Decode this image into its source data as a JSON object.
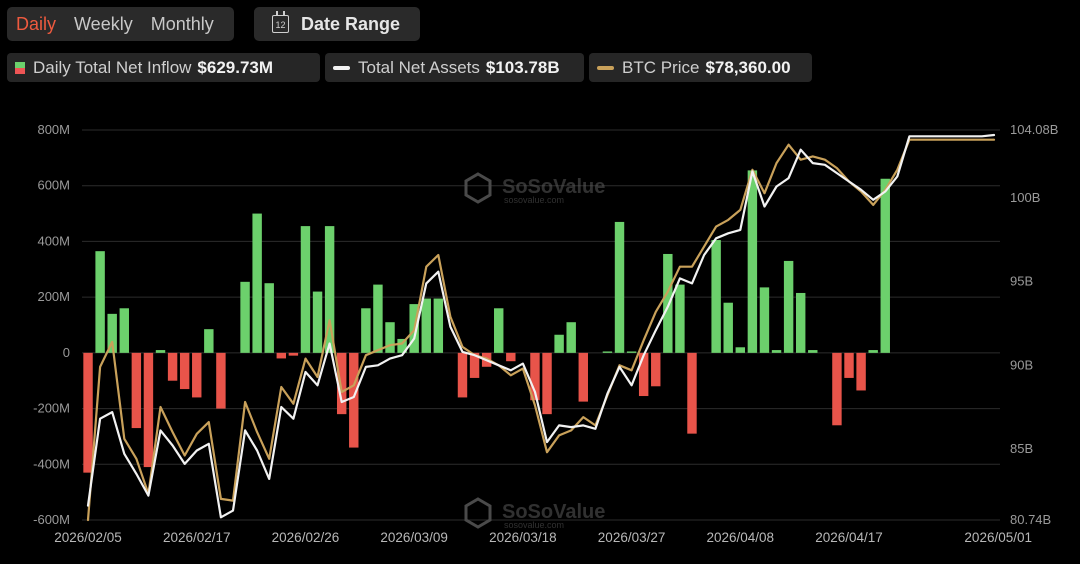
{
  "toolbar": {
    "tabs": [
      "Daily",
      "Weekly",
      "Monthly"
    ],
    "active_tab": "Daily",
    "date_range_label": "Date Range",
    "calendar_icon_text": "12"
  },
  "legend": {
    "inflow": {
      "name": "Daily Total Net Inflow",
      "value": "$629.73M",
      "color_in": "#6cd06c",
      "color_out": "#e8544a"
    },
    "assets": {
      "name": "Total Net Assets",
      "value": "$103.78B",
      "color": "#f2f2f2"
    },
    "btc": {
      "name": "BTC Price",
      "value": "$78,360.00",
      "color": "#c9a15a"
    }
  },
  "watermark": {
    "brand": "SoSoValue",
    "domain": "sosovalue.com"
  },
  "chart_data": {
    "type": "bar+line",
    "left_axis": {
      "ticks": [
        "800M",
        "600M",
        "400M",
        "200M",
        "0",
        "-200M",
        "-400M",
        "-600M"
      ],
      "min": -600,
      "max": 800,
      "unit": "M"
    },
    "right_axis": {
      "ticks": [
        "104.08B",
        "100B",
        "95B",
        "90B",
        "85B",
        "80.74B"
      ],
      "min": 80.74,
      "max": 104.08,
      "unit": "B"
    },
    "x_tick_labels": [
      "2026/02/05",
      "2026/02/17",
      "2026/02/26",
      "2026/03/09",
      "2026/03/18",
      "2026/03/27",
      "2026/04/08",
      "2026/04/17",
      "2026/05/01"
    ],
    "x_tick_index": [
      0,
      9,
      18,
      27,
      36,
      45,
      54,
      63,
      75
    ],
    "grid": true,
    "series": [
      {
        "name": "Daily Total Net Inflow",
        "kind": "bar",
        "unit": "M",
        "values": [
          -430,
          365,
          140,
          160,
          -270,
          -410,
          10,
          -100,
          -130,
          -160,
          85,
          -200,
          0,
          255,
          500,
          250,
          -20,
          -10,
          455,
          220,
          455,
          -220,
          -340,
          160,
          245,
          110,
          50,
          175,
          195,
          195,
          0,
          -160,
          -90,
          -50,
          160,
          -30,
          0,
          -170,
          -220,
          65,
          110,
          -175,
          0,
          5,
          470,
          5,
          -155,
          -120,
          355,
          245,
          -290,
          0,
          405,
          180,
          20,
          655,
          235,
          10,
          330,
          215,
          10,
          0,
          -260,
          -90,
          -135,
          10,
          625,
          0,
          0,
          0,
          0,
          0,
          0,
          0,
          0,
          0
        ]
      },
      {
        "name": "Total Net Assets",
        "kind": "line",
        "unit": "B",
        "values": [
          81.6,
          86.8,
          87.2,
          84.7,
          83.5,
          82.2,
          86.1,
          85.2,
          84.1,
          84.9,
          85.3,
          80.9,
          81.3,
          86.1,
          84.9,
          83.2,
          87.5,
          86.8,
          89.6,
          88.8,
          91.3,
          87.8,
          88.1,
          89.9,
          90.0,
          90.4,
          90.6,
          91.6,
          94.9,
          95.6,
          92.3,
          90.8,
          90.6,
          90.3,
          90.0,
          89.7,
          90.1,
          88.4,
          85.4,
          86.4,
          86.3,
          86.4,
          86.2,
          88.3,
          89.9,
          88.8,
          90.6,
          92.1,
          93.5,
          95.2,
          94.9,
          96.6,
          97.6,
          97.9,
          98.1,
          101.6,
          99.5,
          100.7,
          101.2,
          102.9,
          102.1,
          102.0,
          101.5,
          101.0,
          100.5,
          99.9,
          100.4,
          101.3,
          103.7,
          103.7,
          103.7,
          103.7,
          103.7,
          103.7,
          103.7,
          103.78
        ]
      },
      {
        "name": "BTC Price",
        "kind": "line",
        "unit": "B",
        "values": [
          80.74,
          89.9,
          91.4,
          85.6,
          84.4,
          82.3,
          87.5,
          86.0,
          84.6,
          85.9,
          86.6,
          82.0,
          81.9,
          87.8,
          86.0,
          84.4,
          88.7,
          87.7,
          90.4,
          89.3,
          92.7,
          88.4,
          88.8,
          90.6,
          90.9,
          91.2,
          91.3,
          92.1,
          95.9,
          96.6,
          92.9,
          91.1,
          90.6,
          90.4,
          90.0,
          89.4,
          89.8,
          87.6,
          84.8,
          85.8,
          86.1,
          86.9,
          86.4,
          88.2,
          90.0,
          89.7,
          91.5,
          93.2,
          94.4,
          95.9,
          95.9,
          97.1,
          98.3,
          98.7,
          99.3,
          101.7,
          100.3,
          102.1,
          103.2,
          102.3,
          102.5,
          102.3,
          101.8,
          101.0,
          100.4,
          99.6,
          100.5,
          101.7,
          103.5,
          103.5,
          103.5,
          103.5,
          103.5,
          103.5,
          103.5,
          103.5
        ]
      }
    ]
  }
}
